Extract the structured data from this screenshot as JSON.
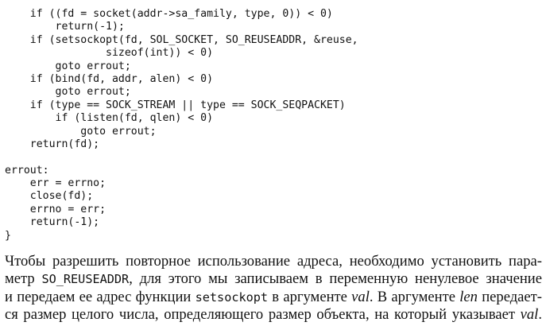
{
  "code": {
    "lines": [
      "    if ((fd = socket(addr->sa_family, type, 0)) < 0)",
      "        return(-1);",
      "    if (setsockopt(fd, SOL_SOCKET, SO_REUSEADDR, &reuse,",
      "                sizeof(int)) < 0)",
      "        goto errout;",
      "    if (bind(fd, addr, alen) < 0)",
      "        goto errout;",
      "    if (type == SOCK_STREAM || type == SOCK_SEQPACKET)",
      "        if (listen(fd, qlen) < 0)",
      "            goto errout;",
      "    return(fd);",
      "",
      "errout:",
      "    err = errno;",
      "    close(fd);",
      "    errno = err;",
      "    return(-1);",
      "}"
    ]
  },
  "paragraph": {
    "l1": "Чтобы разрешить повторное использование адреса, необходимо установить пара-",
    "l2_pre": "метр ",
    "l2_code": "SO_REUSEADDR",
    "l2_post": ", для этого мы записываем в переменную ненулевое значение",
    "l3_pre": "и передаем ее адрес функции ",
    "l3_code": "setsockopt",
    "l3_mid": " в аргументе ",
    "l3_ital": "val",
    "l3_post": ". В аргументе ",
    "l3_ital2": "len",
    "l3_end": " передает-",
    "l4_pre": "ся размер целого числа, определяющего размер объекта, на который указывает ",
    "l4_ital": "val",
    "l4_end": "."
  }
}
